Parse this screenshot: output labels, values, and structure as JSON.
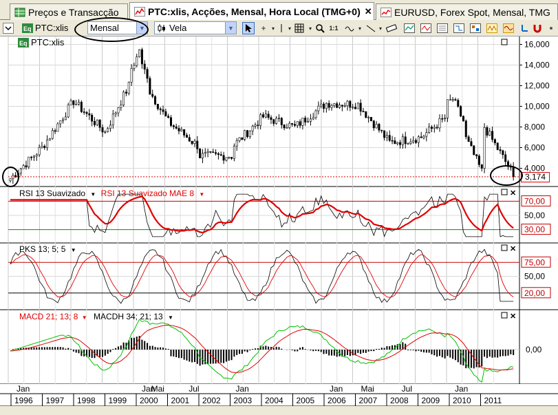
{
  "tabs": [
    {
      "label": "Preços e Transacção",
      "active": false
    },
    {
      "label": "PTC:xlis, Acções, Mensal, Hora Local (TMG+0)",
      "active": true
    },
    {
      "label": "EURUSD, Forex Spot, Mensal, TMG",
      "active": false
    }
  ],
  "toolbar": {
    "symbol_label": "PTC:xlis",
    "period_value": "Mensal",
    "chart_type_value": "Vela"
  },
  "price_panel": {
    "symbol_label": "PTC:xlis",
    "y_ticks": [
      "16,000",
      "14,000",
      "12,000",
      "10,000",
      "8,000",
      "6,000",
      "4,000"
    ],
    "last_price": "3,174"
  },
  "rsi_panel": {
    "label_1": "RSI 13 Suavizado",
    "label_2": "RSI 13 Suavizado MAE 8",
    "ticks": [
      "70,00",
      "50,00",
      "30,00"
    ]
  },
  "pks_panel": {
    "label": "PKS 13; 5; 5",
    "ticks": [
      "75,00",
      "50,00",
      "20,00"
    ]
  },
  "macd_panel": {
    "label_1": "MACD 21; 13; 8",
    "label_2": "MACDH 34; 21; 13",
    "ticks": [
      "0,00"
    ]
  },
  "time_axis": {
    "months": [
      "Jan",
      "Jan",
      "Mai",
      "Jul",
      "Jan",
      "Jan",
      "Mai",
      "Jul",
      "Jan"
    ],
    "years": [
      "1996",
      "1997",
      "1998",
      "1999",
      "2000",
      "2001",
      "2002",
      "2003",
      "2004",
      "2005",
      "2006",
      "2007",
      "2008",
      "2009",
      "2010",
      "2011"
    ]
  },
  "colors": {
    "up_candle": "#ffffff",
    "down_candle": "#000000",
    "rsi_line": "#000000",
    "rsi_mae_line": "#e00000",
    "level_line": "#c00000",
    "macd_signal": "#e00000",
    "macd_line": "#00c000",
    "last_price_line": "#e00000"
  },
  "chart_data": {
    "type": "candlestick",
    "title": "PTC:xlis, Acções, Mensal",
    "x": [
      "1996",
      "1997",
      "1998",
      "1999",
      "2000",
      "2001",
      "2002",
      "2003",
      "2004",
      "2005",
      "2006",
      "2007",
      "2008",
      "2009",
      "2010",
      "2011"
    ],
    "close_approx": [
      3000,
      6000,
      10500,
      7500,
      13500,
      8500,
      6000,
      6000,
      9000,
      8000,
      10300,
      10200,
      6500,
      7000,
      9500,
      3174
    ],
    "ylim": [
      2500,
      16500
    ],
    "last_value": 3.174
  }
}
